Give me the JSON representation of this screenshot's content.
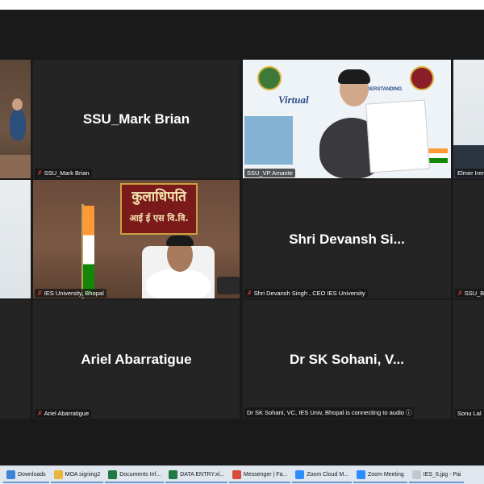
{
  "tiles": {
    "room_left": {
      "label": ""
    },
    "mark_brian": {
      "center_name": "SSU_Mark Brian",
      "label": "SSU_Mark Brian"
    },
    "vp_amante": {
      "label": "SSU_VP Amante",
      "banner_text": "Virtual",
      "banner_text2": "UNDERSTANDING",
      "sign_hindi": ""
    },
    "elmer": {
      "label": "Elmer Irene"
    },
    "left_mid": {
      "label": ""
    },
    "ies_bhopal": {
      "label": "IES University, Bhopal",
      "sign_line1": "कुलाधिपति",
      "sign_line2": "आई ई एस वि.वि."
    },
    "devansh": {
      "center_name": "Shri Devansh Si...",
      "label": "Shri Devansh Singh , CEO IES University"
    },
    "ssu_bry": {
      "label": "SSU_Bry"
    },
    "left_bottom": {
      "label": ""
    },
    "ariel": {
      "center_name": "Ariel Abarratigue",
      "label": "Ariel Abarratigue"
    },
    "sohani": {
      "center_name": "Dr SK Sohani, V...",
      "label": "Dr SK Sohani, VC, IES Univ, Bhopal is connecting to audio"
    },
    "sonu": {
      "label": "Sonu Lal"
    }
  },
  "taskbar": [
    {
      "label": "Downloads",
      "icon": "download-icon",
      "color": "#3a86d4"
    },
    {
      "label": "MOA signing2",
      "icon": "folder-icon",
      "color": "#e8b840"
    },
    {
      "label": "Documents Inf...",
      "icon": "excel-icon",
      "color": "#1f7a44"
    },
    {
      "label": "DATA ENTRY.xl...",
      "icon": "excel-icon",
      "color": "#1f7a44"
    },
    {
      "label": "Messenger | Fa...",
      "icon": "chrome-icon",
      "color": "#d84a3a"
    },
    {
      "label": "Zoom Cloud M...",
      "icon": "zoom-icon",
      "color": "#2d8cff"
    },
    {
      "label": "Zoom Meeting",
      "icon": "zoom-icon",
      "color": "#2d8cff"
    },
    {
      "label": "IES_6.jpg - Pai",
      "icon": "paint-icon",
      "color": "#c0c8d0"
    }
  ]
}
